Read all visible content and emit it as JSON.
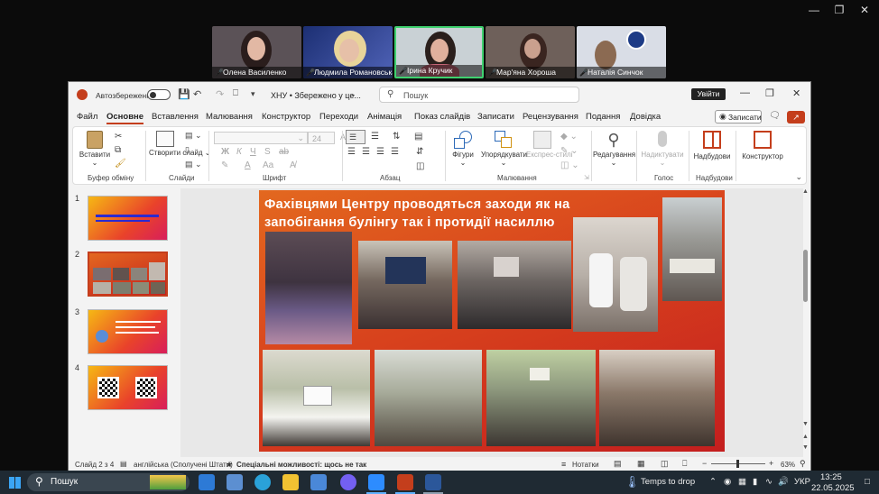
{
  "participants": [
    {
      "name": "Олена Василенко"
    },
    {
      "name": "Людмила Романовська"
    },
    {
      "name": "Ірина Кручик"
    },
    {
      "name": "Мар'яна Хороша"
    },
    {
      "name": "Наталія Синчок"
    }
  ],
  "ppt": {
    "autosave_label": "Автозбереження",
    "filename": "ХНУ • Збережено у це...",
    "search_placeholder": "Пошук",
    "signin_label": "Увійти",
    "record_label": "Записати",
    "menus": [
      "Файл",
      "Основне",
      "Вставлення",
      "Малювання",
      "Конструктор",
      "Переходи",
      "Анімація",
      "Показ слайдів",
      "Записати",
      "Рецензування",
      "Подання",
      "Довідка"
    ],
    "ribbon": {
      "paste": "Вставити",
      "new_slide": "Створити слайд",
      "font_size": "24",
      "shapes": "Фігури",
      "arrange": "Упорядкувати",
      "quick_styles": "Експрес-стилі",
      "editing": "Редагування",
      "dictate": "Надиктувати",
      "addins": "Надбудови",
      "designer": "Конструктор",
      "groups": {
        "clipboard": "Буфер обміну",
        "slides": "Слайди",
        "font": "Шрифт",
        "paragraph": "Абзац",
        "drawing": "Малювання",
        "voice": "Голос",
        "addins": "Надбудови"
      }
    },
    "thumbnails": [
      "1",
      "2",
      "3",
      "4"
    ],
    "slide_title": "Фахівцями Центру проводяться заходи як на запобігання булінгу так і протидії насиллю",
    "status": {
      "slide_count": "Слайд 2 з 4",
      "language": "англійська (Сполучені Штати)",
      "accessibility": "Спеціальні можливості: щось не так",
      "notes": "Нотатки",
      "zoom": "63%"
    }
  },
  "taskbar": {
    "search": "Пошук",
    "weather": "Temps to drop",
    "lang": "УКР",
    "time": "13:25",
    "date": "22.05.2025"
  },
  "colors": {
    "accent": "#c43e1c",
    "taskbar": "#1f2a33",
    "active_speaker": "#3fd16f"
  }
}
